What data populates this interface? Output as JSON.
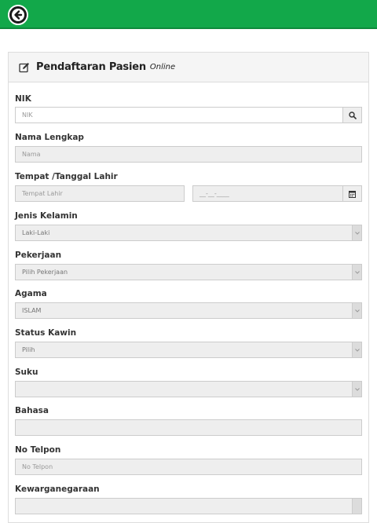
{
  "form": {
    "title": "Pendaftaran Pasien",
    "subtitle": "Online",
    "fields": {
      "nik": {
        "label": "NIK",
        "placeholder": "NIK"
      },
      "nama": {
        "label": "Nama Lengkap",
        "placeholder": "Nama"
      },
      "ttl": {
        "label": "Tempat /Tanggal Lahir",
        "place_placeholder": "Tempat Lahir",
        "date_placeholder": "__-__-____"
      },
      "jenis_kelamin": {
        "label": "Jenis Kelamin",
        "value": "Laki-Laki"
      },
      "pekerjaan": {
        "label": "Pekerjaan",
        "value": "Pilih Pekerjaan"
      },
      "agama": {
        "label": "Agama",
        "value": "ISLAM"
      },
      "status_kawin": {
        "label": "Status Kawin",
        "value": "Pilih"
      },
      "suku": {
        "label": "Suku",
        "value": ""
      },
      "bahasa": {
        "label": "Bahasa",
        "value": ""
      },
      "telpon": {
        "label": "No Telpon",
        "placeholder": "No Telpon"
      },
      "kewarganegaraan": {
        "label": "Kewarganegaraan"
      }
    }
  },
  "icons": {
    "back": "arrow-left-circle",
    "edit": "pencil-square",
    "search": "magnifier",
    "calendar": "calendar",
    "dropdown": "chevron-down"
  },
  "colors": {
    "topbar": "#12a84a",
    "panel_head": "#f5f5f5",
    "input_disabled": "#eeeeee"
  }
}
